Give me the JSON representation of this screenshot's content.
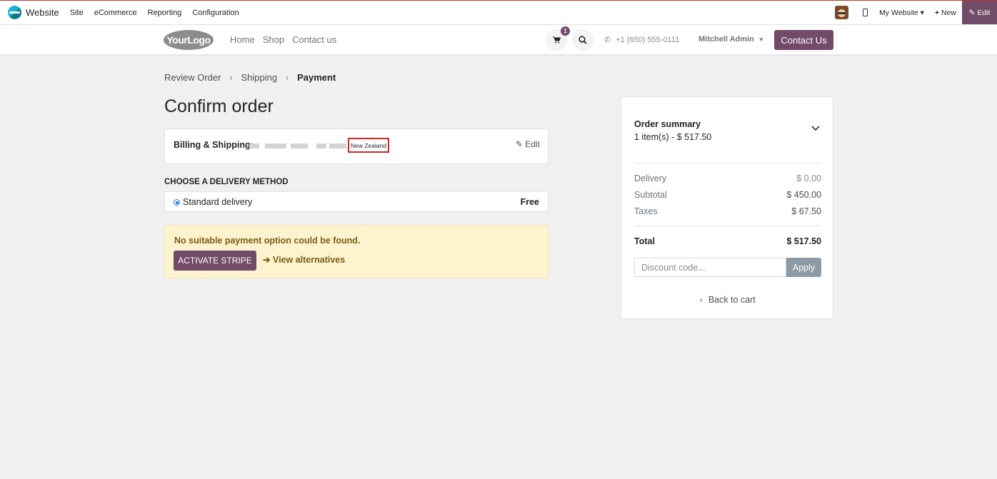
{
  "adminbar": {
    "app_name": "Website",
    "menu": [
      "Site",
      "eCommerce",
      "Reporting",
      "Configuration"
    ],
    "my_website": "My Website",
    "new_label": "New",
    "edit_label": "Edit"
  },
  "site": {
    "logo_text": "YourLogo",
    "nav": [
      "Home",
      "Shop",
      "Contact us"
    ],
    "cart_count": "1",
    "phone": "+1 (650) 555-0111",
    "user": "Mitchell Admin",
    "contact_button": "Contact Us"
  },
  "breadcrumb": {
    "steps": [
      "Review Order",
      "Shipping",
      "Payment"
    ],
    "active": "Payment"
  },
  "page_title": "Confirm order",
  "billing": {
    "label": "Billing & Shipping:",
    "country": "New Zealand",
    "edit_label": "Edit"
  },
  "delivery": {
    "heading": "CHOOSE A DELIVERY METHOD",
    "method": "Standard delivery",
    "price": "Free"
  },
  "payment_warning": {
    "message": "No suitable payment option could be found.",
    "activate_button": "ACTIVATE STRIPE",
    "alternatives_link": "View alternatives"
  },
  "summary": {
    "title": "Order summary",
    "items": "1 item(s) -  $ 517.50",
    "delivery_label": "Delivery",
    "delivery_value": "$ 0.00",
    "subtotal_label": "Subtotal",
    "subtotal_value": "$ 450.00",
    "taxes_label": "Taxes",
    "taxes_value": "$ 67.50",
    "total_label": "Total",
    "total_value": "$ 517.50",
    "discount_placeholder": "Discount code...",
    "apply_label": "Apply",
    "back_label": "Back to cart"
  },
  "colors": {
    "brand": "#714b67",
    "warning_bg": "#fdf3cf",
    "highlight_border": "#d02727"
  }
}
